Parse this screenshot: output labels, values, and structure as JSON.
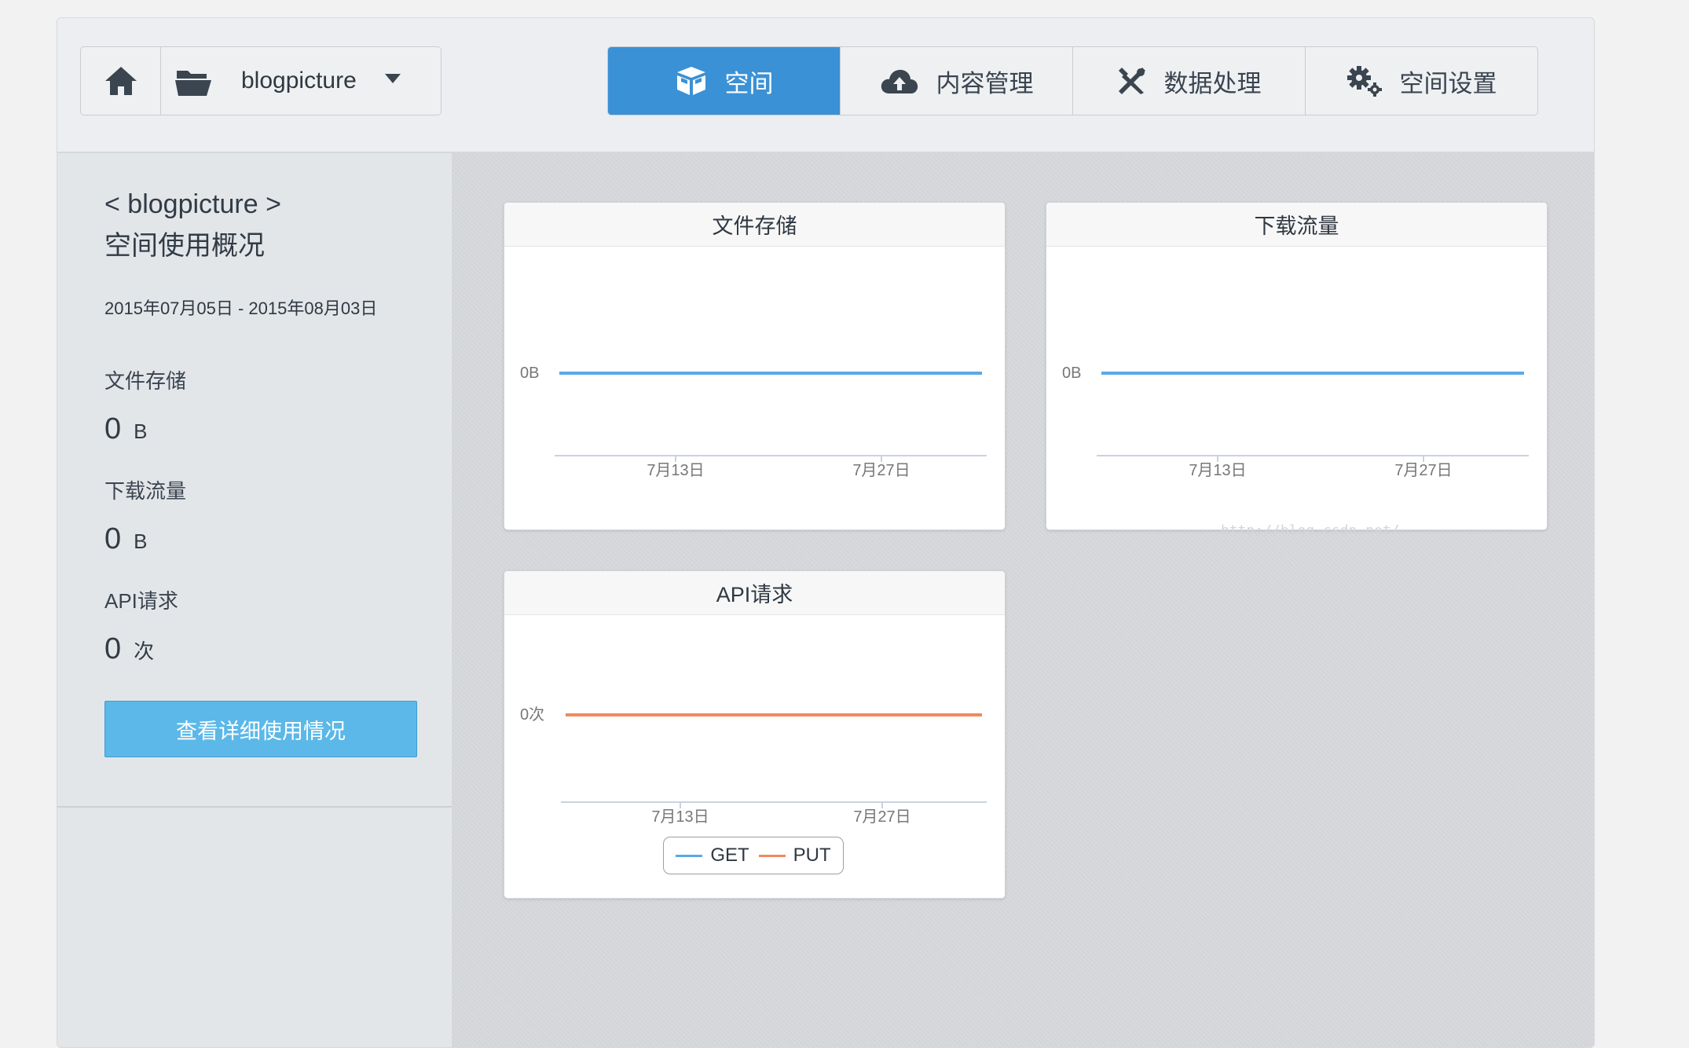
{
  "header": {
    "bucket_name": "blogpicture",
    "tabs": [
      {
        "label": "空间",
        "icon": "box-icon",
        "active": true
      },
      {
        "label": "内容管理",
        "icon": "cloud-upload-icon",
        "active": false
      },
      {
        "label": "数据处理",
        "icon": "tools-icon",
        "active": false
      },
      {
        "label": "空间设置",
        "icon": "gears-icon",
        "active": false
      }
    ],
    "colors": {
      "active_tab": "#3a91d6"
    }
  },
  "sidebar": {
    "title_line1": "< blogpicture >",
    "title_line2": "空间使用概况",
    "date_range": "2015年07月05日 - 2015年08月03日",
    "stats": [
      {
        "label": "文件存储",
        "value": "0",
        "unit": "B"
      },
      {
        "label": "下载流量",
        "value": "0",
        "unit": "B"
      },
      {
        "label": "API请求",
        "value": "0",
        "unit": "次"
      }
    ],
    "detail_button": "查看详细使用情况"
  },
  "charts": {
    "storage": {
      "title": "文件存储"
    },
    "traffic": {
      "title": "下载流量"
    },
    "api": {
      "title": "API请求"
    }
  },
  "chart_data": [
    {
      "type": "line",
      "title": "文件存储",
      "x": [
        "2015-07-05",
        "2015-08-03"
      ],
      "x_ticks": [
        "7月13日",
        "7月27日"
      ],
      "y_ticks": [
        "0B"
      ],
      "series": [
        {
          "values": [
            0,
            0
          ],
          "color": "#5aa9e6"
        }
      ]
    },
    {
      "type": "line",
      "title": "下载流量",
      "x": [
        "2015-07-05",
        "2015-08-03"
      ],
      "x_ticks": [
        "7月13日",
        "7月27日"
      ],
      "y_ticks": [
        "0B"
      ],
      "series": [
        {
          "values": [
            0,
            0
          ],
          "color": "#5aa9e6"
        }
      ]
    },
    {
      "type": "line",
      "title": "API请求",
      "x": [
        "2015-07-05",
        "2015-08-03"
      ],
      "x_ticks": [
        "7月13日",
        "7月27日"
      ],
      "y_ticks": [
        "0次"
      ],
      "series": [
        {
          "name": "GET",
          "values": [
            0,
            0
          ],
          "color": "#5aa9e6"
        },
        {
          "name": "PUT",
          "values": [
            0,
            0
          ],
          "color": "#f08a5d"
        }
      ],
      "legend": "bottom"
    }
  ],
  "watermark": "http://blog.csdn.net/"
}
